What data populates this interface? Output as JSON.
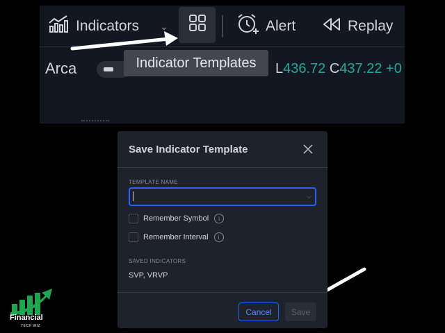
{
  "toolbar": {
    "indicators_label": "Indicators",
    "alert_label": "Alert",
    "replay_label": "Replay",
    "tooltip": "Indicator Templates"
  },
  "symbol_bar": {
    "exchange": "Arca",
    "low_key": "L",
    "low_value": "436.72",
    "close_key": "C",
    "close_value": "437.22",
    "change": "+0"
  },
  "dialog": {
    "title": "Save Indicator Template",
    "template_name_label": "TEMPLATE NAME",
    "template_name_value": "",
    "remember_symbol_label": "Remember Symbol",
    "remember_symbol_checked": false,
    "remember_interval_label": "Remember Interval",
    "remember_interval_checked": false,
    "saved_indicators_label": "SAVED INDICATORS",
    "saved_indicators_value": "SVP, VRVP",
    "cancel_label": "Cancel",
    "save_label": "Save"
  },
  "logo": {
    "name": "Financial",
    "tagline": "TECH WIZ"
  },
  "colors": {
    "accent": "#2962ff",
    "price_up": "#26a69a",
    "panel": "#1e222d",
    "toolbar": "#131722",
    "logo_green": "#1ea650"
  },
  "icons": [
    "indicators-icon",
    "templates-grid-icon",
    "alert-clock-icon",
    "replay-icon",
    "close-icon",
    "info-icon",
    "chevron-down-icon",
    "pointer-arrow-icon"
  ]
}
